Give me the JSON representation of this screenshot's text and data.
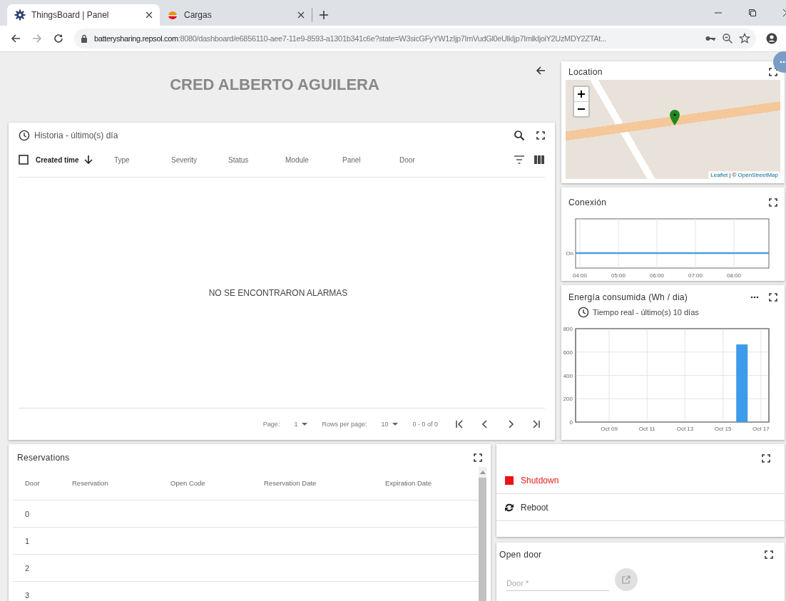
{
  "browser": {
    "tabs": [
      {
        "title": "ThingsBoard | Panel",
        "selected": true,
        "kind": "gear"
      },
      {
        "title": "Cargas",
        "selected": false,
        "kind": "logo"
      }
    ],
    "url_host": "batterysharing.repsol.com",
    "url_rest": ":8080/dashboard/e6856110-aee7-11e9-8593-a1301b341c6e?state=W3sicGFyYW1zIjp7ImVudGl0eUlkIjp7ImlkIjoiY2UzMDY2ZTAt..."
  },
  "dashboard": {
    "title": "CRED ALBERTO AGUILERA"
  },
  "alarms": {
    "title": "Historia - último(s) día",
    "columns": [
      {
        "label": "Created time",
        "sorted": true
      },
      {
        "label": "Type",
        "sorted": false
      },
      {
        "label": "Severity",
        "sorted": false
      },
      {
        "label": "Status",
        "sorted": false
      },
      {
        "label": "Module",
        "sorted": false
      },
      {
        "label": "Panel",
        "sorted": false
      },
      {
        "label": "Door",
        "sorted": false
      }
    ],
    "select_all_checked": false,
    "empty_message": "NO SE ENCONTRARON ALARMAS",
    "pagination": {
      "page_label": "Page:",
      "page": "1",
      "rows_label": "Rows per page:",
      "rows": "10",
      "range": "0 - 0 of 0"
    }
  },
  "location": {
    "title": "Location",
    "attribution_leaflet": "Leaflet",
    "attribution_sep": "| ©",
    "attribution_osm": "OpenStreetMap"
  },
  "conexion": {
    "title": "Conexión",
    "y_labels": [
      "On"
    ],
    "x_labels": [
      "04:00",
      "05:00",
      "06:00",
      "07:00",
      "08:00"
    ]
  },
  "energia": {
    "title": "Energía consumida (Wh / dia)",
    "timewindow": "Tiempo real - último(s) 10 días",
    "chart_data": {
      "type": "bar",
      "categories": [
        null,
        null,
        "Oct 09",
        null,
        "Oct 11",
        null,
        "Oct 13",
        null,
        "Oct 15",
        null,
        "Oct 17"
      ],
      "series": [
        {
          "color": "#3d9be9",
          "values": [
            null,
            null,
            null,
            null,
            null,
            null,
            null,
            null,
            null,
            665,
            null
          ]
        }
      ],
      "ylim": [
        0,
        800
      ],
      "yticks": [
        0,
        200,
        400,
        600,
        800
      ],
      "grid": true
    }
  },
  "reservations": {
    "title": "Reservations",
    "columns": [
      "Door",
      "Reservation",
      "Open Code",
      "Reservation Date",
      "Expiration Date"
    ],
    "rows": [
      {
        "door": "0"
      },
      {
        "door": "1"
      },
      {
        "door": "2"
      },
      {
        "door": "3"
      }
    ]
  },
  "rpc": {
    "buttons": [
      {
        "label": "Shutdown",
        "kind": "stop"
      },
      {
        "label": "Reboot",
        "kind": "refresh"
      }
    ]
  },
  "open_door": {
    "title": "Open door",
    "field": {
      "placeholder": "Door *"
    },
    "send_disabled": true
  }
}
